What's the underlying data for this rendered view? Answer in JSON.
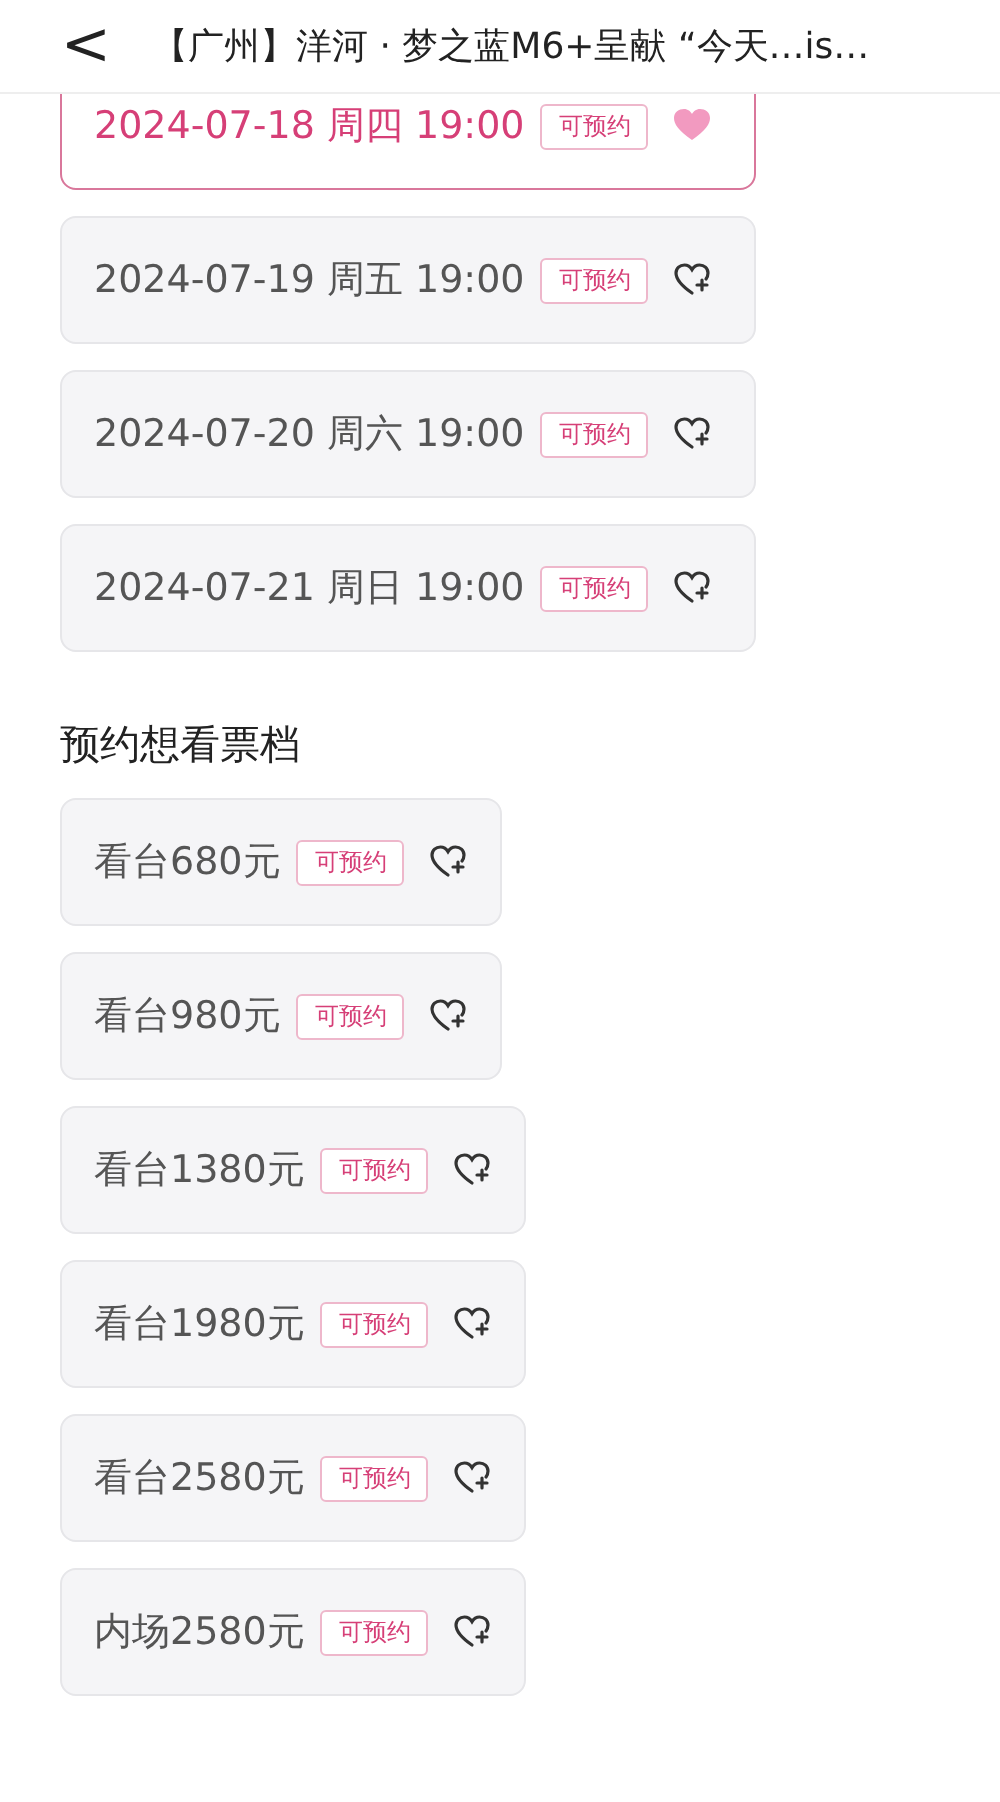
{
  "header": {
    "back": "<",
    "title": "【广州】洋河 · 梦之蓝M6+呈献 “今天…is…"
  },
  "sessions": [
    {
      "label": "2024-07-18 周四 19:00",
      "tag": "可预约",
      "selected": true
    },
    {
      "label": "2024-07-19 周五 19:00",
      "tag": "可预约",
      "selected": false
    },
    {
      "label": "2024-07-20 周六 19:00",
      "tag": "可预约",
      "selected": false
    },
    {
      "label": "2024-07-21 周日 19:00",
      "tag": "可预约",
      "selected": false
    }
  ],
  "tiers_title": "预约想看票档",
  "tiers": [
    {
      "label": "看台680元",
      "tag": "可预约",
      "selected": false
    },
    {
      "label": "看台980元",
      "tag": "可预约",
      "selected": false
    },
    {
      "label": "看台1380元",
      "tag": "可预约",
      "selected": false
    },
    {
      "label": "看台1980元",
      "tag": "可预约",
      "selected": false
    },
    {
      "label": "看台2580元",
      "tag": "可预约",
      "selected": false
    },
    {
      "label": "内场2580元",
      "tag": "可预约",
      "selected": false
    }
  ]
}
